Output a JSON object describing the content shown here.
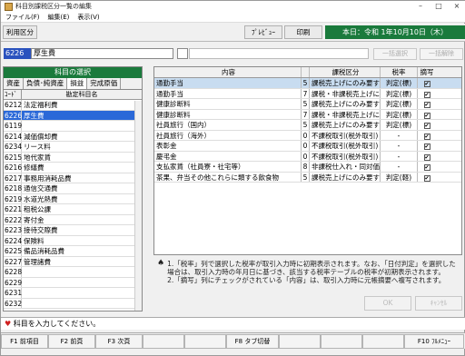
{
  "window": {
    "title": "科目別課税区分一覧の編集"
  },
  "menu": [
    "ファイル(F)",
    "編集(E)",
    "表示(V)"
  ],
  "toolbar": {
    "usage_label": "利用区分",
    "preview_label": "ﾌﾟﾚﾋﾞｭｰ",
    "print_label": "印刷",
    "date": "本日：令和 1年10月10日（木）"
  },
  "selection": {
    "code": "6226",
    "name": "厚生費",
    "batch_select_label": "一括選択",
    "batch_clear_label": "一括解除"
  },
  "left_panel": {
    "header": "科目の選択",
    "tabs": [
      "資産",
      "負債･純資産",
      "損益",
      "完成原価"
    ],
    "columns": [
      "ｺｰﾄﾞ",
      "勘定科目名"
    ],
    "rows": [
      {
        "code": "6212",
        "name": "法定福利費"
      },
      {
        "code": "6226",
        "name": "厚生費"
      },
      {
        "code": "6119",
        "name": ""
      },
      {
        "code": "6214",
        "name": "減価償却費"
      },
      {
        "code": "6234",
        "name": "リース料"
      },
      {
        "code": "6215",
        "name": "地代家賃"
      },
      {
        "code": "6216",
        "name": "修繕費"
      },
      {
        "code": "6217",
        "name": "事務用消耗品費"
      },
      {
        "code": "6218",
        "name": "通信交通費"
      },
      {
        "code": "6219",
        "name": "水道光熱費"
      },
      {
        "code": "6221",
        "name": "租税公課"
      },
      {
        "code": "6222",
        "name": "寄付金"
      },
      {
        "code": "6223",
        "name": "接待交際費"
      },
      {
        "code": "6224",
        "name": "保険料"
      },
      {
        "code": "6225",
        "name": "備品消耗品費"
      },
      {
        "code": "6227",
        "name": "管理諸費"
      },
      {
        "code": "6228",
        "name": ""
      },
      {
        "code": "6229",
        "name": ""
      },
      {
        "code": "6231",
        "name": ""
      },
      {
        "code": "6232",
        "name": ""
      }
    ]
  },
  "right_panel": {
    "columns": [
      "内容",
      "課税区分",
      "税率",
      "摘写"
    ],
    "rows": [
      {
        "content": "通勤手当",
        "kbn": "5",
        "tax": "課税売上げにのみ要する",
        "rate": "判定(標)",
        "checked": true
      },
      {
        "content": "通勤手当",
        "kbn": "7",
        "tax": "課税・非課税売上げに共",
        "rate": "判定(標)",
        "checked": true
      },
      {
        "content": "健康診断料",
        "kbn": "5",
        "tax": "課税売上げにのみ要する",
        "rate": "判定(標)",
        "checked": true
      },
      {
        "content": "健康診断料",
        "kbn": "7",
        "tax": "課税・非課税売上げに共",
        "rate": "判定(標)",
        "checked": true
      },
      {
        "content": "社員旅行（国内）",
        "kbn": "5",
        "tax": "課税売上げにのみ要する",
        "rate": "判定(標)",
        "checked": true
      },
      {
        "content": "社員旅行（海外）",
        "kbn": "0",
        "tax": "不課税取引(税外取引)",
        "rate": "-",
        "checked": true
      },
      {
        "content": "表彰金",
        "kbn": "0",
        "tax": "不課税取引(税外取引)",
        "rate": "-",
        "checked": true
      },
      {
        "content": "慶弔金",
        "kbn": "0",
        "tax": "不課税取引(税外取引)",
        "rate": "-",
        "checked": true
      },
      {
        "content": "支払家賃（社員寮・社宅等）",
        "kbn": "8",
        "tax": "非課税仕入れ・同対価",
        "rate": "-",
        "checked": true
      },
      {
        "content": "茶果、弁当その他これらに類する飲食物",
        "kbn": "5",
        "tax": "課税売上げにのみ要する",
        "rate": "判定(軽)",
        "checked": true
      }
    ]
  },
  "notes": {
    "line1": "1.「税率」列で選択した税率が取引入力時に初期表示されます。なお、「日付判定」を選択した場合は、取引入力時の年月日に基づき、該当する税率テーブルの税率が初期表示されます。",
    "line2": "2.「摘写」列にチェックがされている「内容」は、取引入力時に元帳摘要へ複写されます。"
  },
  "buttons": {
    "ok": "OK",
    "cancel": "ｷｬﾝｾﾙ"
  },
  "status": "科目を入力してください。",
  "fkeys": [
    {
      "label": "F1 前項目"
    },
    {
      "label": "F2 前頁"
    },
    {
      "label": "F3 次頁"
    },
    {
      "label": ""
    },
    {
      "label": ""
    },
    {
      "label": "F8 タブ切替"
    },
    {
      "label": ""
    },
    {
      "label": ""
    },
    {
      "label": ""
    },
    {
      "label": "F10 ﾌﾙﾒﾆｭｰ"
    }
  ]
}
